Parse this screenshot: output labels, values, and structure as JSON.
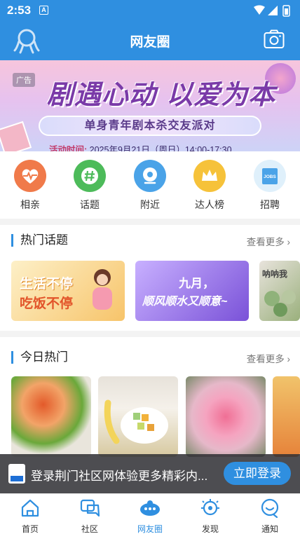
{
  "status_bar": {
    "time": "2:53",
    "notification_icon": "A"
  },
  "header": {
    "title": "网友圈",
    "left_icon": "octopus-logo-icon",
    "right_icon": "camera-icon"
  },
  "banner": {
    "ad_label": "广告",
    "headline": "剧遇心动 以爱为本",
    "subtitle": "单身青年剧本杀交友派对",
    "activity_label": "活动时间:",
    "activity_time": "2025年9月21日（周日）14:00-17:30"
  },
  "quick_links": [
    {
      "label": "相亲",
      "icon": "heartbeat-icon",
      "color": "#f07a4a"
    },
    {
      "label": "话题",
      "icon": "hashtag-icon",
      "color": "#4dbb5a"
    },
    {
      "label": "附近",
      "icon": "location-icon",
      "color": "#4aa3e8"
    },
    {
      "label": "达人榜",
      "icon": "crown-icon",
      "color": "#f6c23a"
    },
    {
      "label": "招聘",
      "icon": "jobs-icon",
      "color": "#4aa3e8"
    }
  ],
  "hot_topics": {
    "title": "热门话题",
    "more": "查看更多",
    "cards": [
      {
        "line1": "生活不停",
        "line2": "吃饭不停"
      },
      {
        "line1": "九月，",
        "line2": "顺风顺水又顺意~"
      },
      {
        "line1": "呐呐我"
      }
    ]
  },
  "today_hot": {
    "title": "今日热门",
    "more": "查看更多"
  },
  "login_bar": {
    "message": "登录荆门社区网体验更多精彩内...",
    "button": "立即登录"
  },
  "bottom_nav": [
    {
      "label": "首页",
      "icon": "home-icon",
      "active": false
    },
    {
      "label": "社区",
      "icon": "community-icon",
      "active": false
    },
    {
      "label": "网友圈",
      "icon": "friends-circle-icon",
      "active": true
    },
    {
      "label": "发现",
      "icon": "discover-icon",
      "active": false
    },
    {
      "label": "通知",
      "icon": "notification-icon",
      "active": false
    }
  ],
  "colors": {
    "primary": "#2f8fe0",
    "separator": "#f3f3f3"
  }
}
